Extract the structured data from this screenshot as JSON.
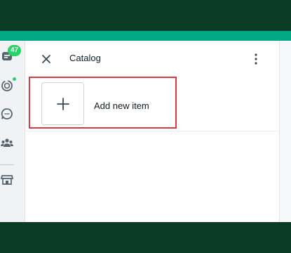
{
  "rail": {
    "chats_badge": "47"
  },
  "panel": {
    "title": "Catalog",
    "add_item_label": "Add new item"
  },
  "colors": {
    "accent": "#00a884",
    "badge": "#25d366",
    "highlight_border": "#e0383e",
    "dark_frame": "#0b3b24"
  },
  "icons": [
    "chats-icon",
    "status-icon",
    "channels-icon",
    "communities-icon",
    "store-icon",
    "close-icon",
    "more-vertical-icon",
    "plus-icon"
  ]
}
